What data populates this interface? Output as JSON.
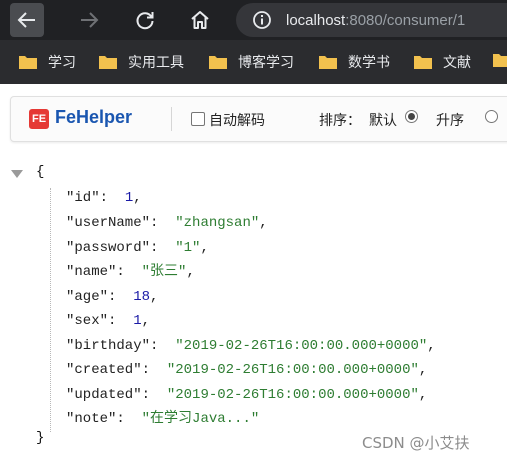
{
  "browser": {
    "url_host": "localhost",
    "url_rest": ":8080/consumer/1"
  },
  "bookmarks": [
    {
      "label": "学习"
    },
    {
      "label": "实用工具"
    },
    {
      "label": "博客学习"
    },
    {
      "label": "数学书"
    },
    {
      "label": "文献"
    }
  ],
  "fehelper": {
    "logo": "FE",
    "name": "FeHelper",
    "auto_decode_label": "自动解码",
    "sort_label": "排序：",
    "sort_default": "默认",
    "sort_asc": "升序"
  },
  "json_view": {
    "open_brace": "{",
    "close_brace": "}",
    "rows": [
      {
        "key": "\"id\"",
        "value": "1",
        "type": "num",
        "comma": true
      },
      {
        "key": "\"userName\"",
        "value": "\"zhangsan\"",
        "type": "str",
        "comma": true
      },
      {
        "key": "\"password\"",
        "value": "\"1\"",
        "type": "str",
        "comma": true
      },
      {
        "key": "\"name\"",
        "value": "\"张三\"",
        "type": "str",
        "comma": true
      },
      {
        "key": "\"age\"",
        "value": "18",
        "type": "num",
        "comma": true
      },
      {
        "key": "\"sex\"",
        "value": "1",
        "type": "num",
        "comma": true
      },
      {
        "key": "\"birthday\"",
        "value": "\"2019-02-26T16:00:00.000+0000\"",
        "type": "str",
        "comma": true
      },
      {
        "key": "\"created\"",
        "value": "\"2019-02-26T16:00:00.000+0000\"",
        "type": "str",
        "comma": true
      },
      {
        "key": "\"updated\"",
        "value": "\"2019-02-26T16:00:00.000+0000\"",
        "type": "str",
        "comma": true
      },
      {
        "key": "\"note\"",
        "value": "\"在学习Java...\"",
        "type": "str",
        "comma": false
      }
    ]
  },
  "watermark": "CSDN @小艾扶",
  "colors": {
    "topbar": "#202124",
    "bookmarks_bar": "#2b2c2f",
    "folder": "#f2c14e",
    "json_string": "#2e7d32",
    "json_number": "#1a1aa6",
    "fehelper_brand": "#1a56b0",
    "fehelper_logo": "#e53935"
  },
  "icons": {
    "back": "arrow-left-icon",
    "forward": "arrow-right-icon",
    "reload": "reload-icon",
    "home": "home-icon",
    "info": "info-circle-icon",
    "folder": "folder-icon",
    "collapse": "triangle-down-icon"
  }
}
